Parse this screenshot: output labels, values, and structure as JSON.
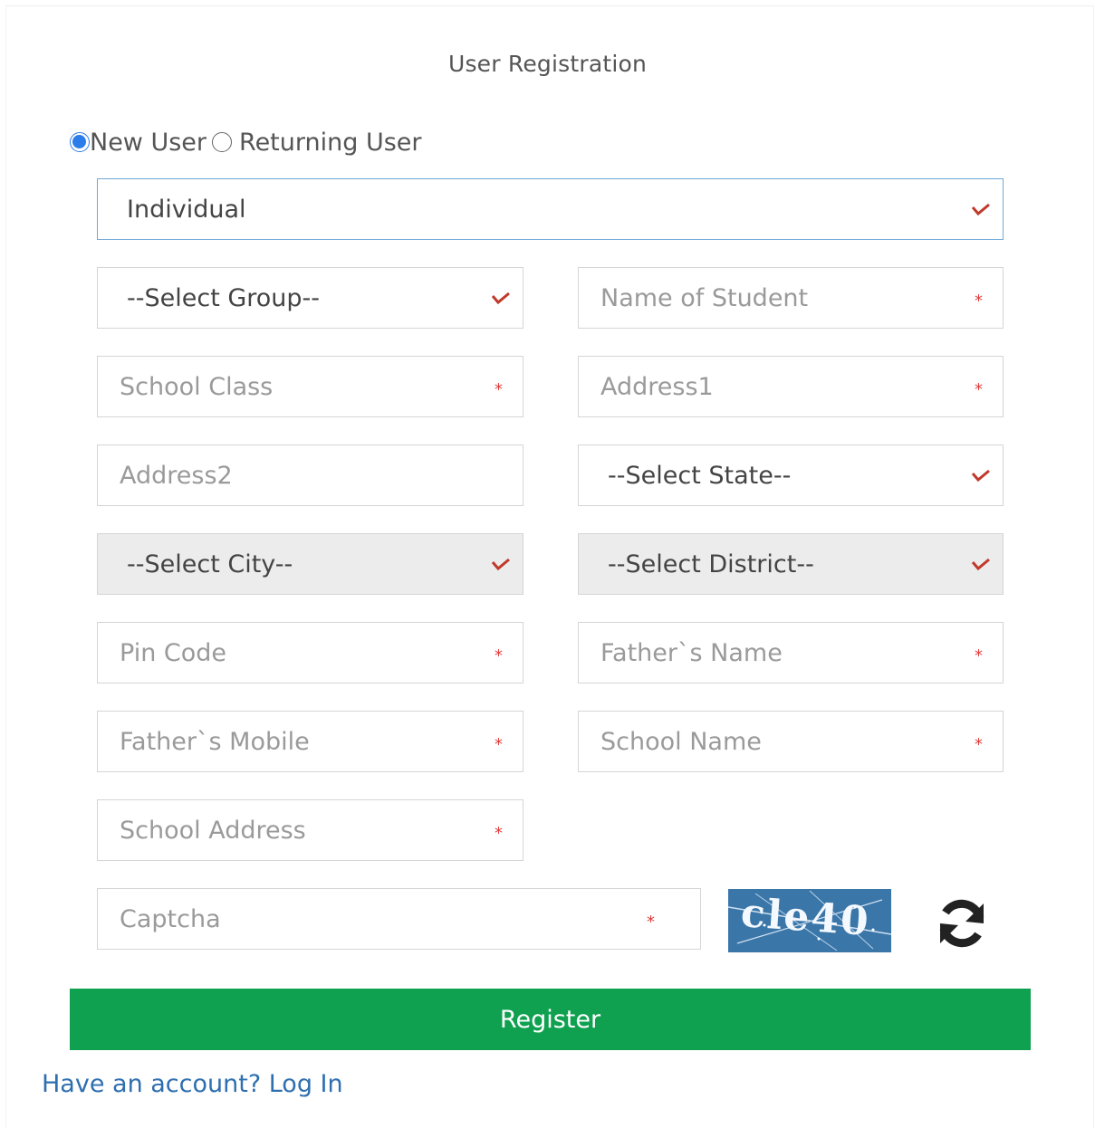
{
  "title": "User Registration",
  "user_type": {
    "new_label": "New User",
    "returning_label": "Returning User",
    "selected": "new"
  },
  "registration_type": {
    "value": "Individual"
  },
  "fields": {
    "group": "--Select Group--",
    "student_name": "Name of Student",
    "school_class": "School Class",
    "address1": "Address1",
    "address2": "Address2",
    "state": "--Select State--",
    "city": "--Select City--",
    "district": "--Select District--",
    "pin_code": "Pin Code",
    "father_name": "Father`s Name",
    "father_mobile": "Father`s Mobile",
    "school_name": "School Name",
    "school_address": "School Address",
    "captcha": "Captcha"
  },
  "required_mark": "*",
  "captcha_image_text": "cle40",
  "register_label": "Register",
  "login_link": "Have an account? Log In",
  "colors": {
    "accent": "#10a150",
    "link": "#2e6fb0",
    "required": "#e03b3b",
    "radio": "#2b7de9"
  }
}
